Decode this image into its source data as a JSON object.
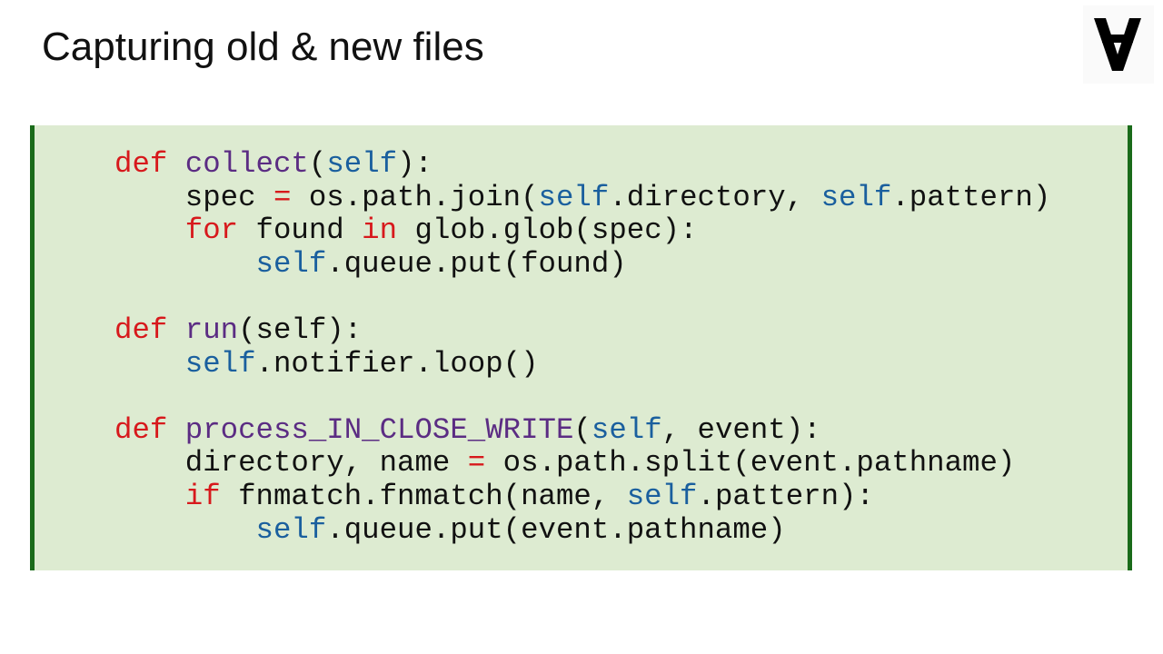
{
  "slide": {
    "title": "Capturing old & new files"
  },
  "logo": {
    "icon": "for-all-symbol-icon",
    "glyph": "∀"
  },
  "code_block": {
    "language": "python",
    "lines": [
      [
        {
          "t": "def",
          "c": "kw"
        },
        {
          "t": " "
        },
        {
          "t": "collect",
          "c": "fn"
        },
        {
          "t": "("
        },
        {
          "t": "self",
          "c": "sf"
        },
        {
          "t": "):"
        }
      ],
      [
        {
          "t": "    spec "
        },
        {
          "t": "=",
          "c": "op"
        },
        {
          "t": " os.path.join("
        },
        {
          "t": "self",
          "c": "sf"
        },
        {
          "t": ".directory, "
        },
        {
          "t": "self",
          "c": "sf"
        },
        {
          "t": ".pattern)"
        }
      ],
      [
        {
          "t": "    "
        },
        {
          "t": "for",
          "c": "kw"
        },
        {
          "t": " found "
        },
        {
          "t": "in",
          "c": "kw"
        },
        {
          "t": " glob.glob(spec):"
        }
      ],
      [
        {
          "t": "        "
        },
        {
          "t": "self",
          "c": "sf"
        },
        {
          "t": ".queue.put(found)"
        }
      ],
      [],
      [
        {
          "t": "def",
          "c": "kw"
        },
        {
          "t": " "
        },
        {
          "t": "run",
          "c": "fn"
        },
        {
          "t": "(self):"
        }
      ],
      [
        {
          "t": "    "
        },
        {
          "t": "self",
          "c": "sf"
        },
        {
          "t": ".notifier.loop()"
        }
      ],
      [],
      [
        {
          "t": "def",
          "c": "kw"
        },
        {
          "t": " "
        },
        {
          "t": "process_IN_CLOSE_WRITE",
          "c": "fn"
        },
        {
          "t": "("
        },
        {
          "t": "self",
          "c": "sf"
        },
        {
          "t": ", event):"
        }
      ],
      [
        {
          "t": "    directory, name "
        },
        {
          "t": "=",
          "c": "op"
        },
        {
          "t": " os.path.split(event.pathname)"
        }
      ],
      [
        {
          "t": "    "
        },
        {
          "t": "if",
          "c": "kw"
        },
        {
          "t": " fnmatch.fnmatch(name, "
        },
        {
          "t": "self",
          "c": "sf"
        },
        {
          "t": ".pattern):"
        }
      ],
      [
        {
          "t": "        "
        },
        {
          "t": "self",
          "c": "sf"
        },
        {
          "t": ".queue.put(event.pathname)"
        }
      ]
    ]
  },
  "colors": {
    "keyword": "#d7191c",
    "function_name": "#5b2c83",
    "self": "#1a5f9e",
    "panel_background": "#ddebd1",
    "panel_border": "#1a6b1a",
    "text": "#111111"
  }
}
